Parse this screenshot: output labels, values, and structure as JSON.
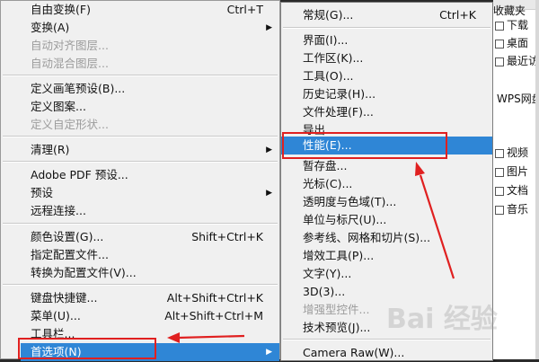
{
  "edit_menu": {
    "items": [
      {
        "label": "自由变换(F)",
        "shortcut": "Ctrl+T",
        "disabled": false
      },
      {
        "label": "变换(A)",
        "shortcut": "",
        "disabled": false
      },
      {
        "label": "自动对齐图层...",
        "shortcut": "",
        "disabled": true
      },
      {
        "label": "自动混合图层...",
        "shortcut": "",
        "disabled": true
      },
      {
        "label": "定义画笔预设(B)...",
        "shortcut": "",
        "disabled": false
      },
      {
        "label": "定义图案...",
        "shortcut": "",
        "disabled": false
      },
      {
        "label": "定义自定形状...",
        "shortcut": "",
        "disabled": true
      },
      {
        "label": "清理(R)",
        "shortcut": "",
        "disabled": false
      },
      {
        "label": "Adobe PDF 预设...",
        "shortcut": "",
        "disabled": false
      },
      {
        "label": "预设",
        "shortcut": "",
        "disabled": false
      },
      {
        "label": "远程连接...",
        "shortcut": "",
        "disabled": false
      },
      {
        "label": "颜色设置(G)...",
        "shortcut": "Shift+Ctrl+K",
        "disabled": false
      },
      {
        "label": "指定配置文件...",
        "shortcut": "",
        "disabled": false
      },
      {
        "label": "转换为配置文件(V)...",
        "shortcut": "",
        "disabled": false
      },
      {
        "label": "键盘快捷键...",
        "shortcut": "Alt+Shift+Ctrl+K",
        "disabled": false
      },
      {
        "label": "菜单(U)...",
        "shortcut": "Alt+Shift+Ctrl+M",
        "disabled": false
      },
      {
        "label": "工具栏...",
        "shortcut": "",
        "disabled": false
      },
      {
        "label": "首选项(N)",
        "shortcut": "",
        "disabled": false
      }
    ]
  },
  "pref_menu": {
    "items": [
      {
        "label": "常规(G)...",
        "shortcut": "Ctrl+K",
        "disabled": false
      },
      {
        "label": "界面(I)...",
        "shortcut": "",
        "disabled": false
      },
      {
        "label": "工作区(K)...",
        "shortcut": "",
        "disabled": false
      },
      {
        "label": "工具(O)...",
        "shortcut": "",
        "disabled": false
      },
      {
        "label": "历史记录(H)...",
        "shortcut": "",
        "disabled": false
      },
      {
        "label": "文件处理(F)...",
        "shortcut": "",
        "disabled": false
      },
      {
        "label": "导出...",
        "shortcut": "",
        "disabled": false
      },
      {
        "label": "性能(E)...",
        "shortcut": "",
        "disabled": false
      },
      {
        "label": "暂存盘...",
        "shortcut": "",
        "disabled": false
      },
      {
        "label": "光标(C)...",
        "shortcut": "",
        "disabled": false
      },
      {
        "label": "透明度与色域(T)...",
        "shortcut": "",
        "disabled": false
      },
      {
        "label": "单位与标尺(U)...",
        "shortcut": "",
        "disabled": false
      },
      {
        "label": "参考线、网格和切片(S)...",
        "shortcut": "",
        "disabled": false
      },
      {
        "label": "增效工具(P)...",
        "shortcut": "",
        "disabled": false
      },
      {
        "label": "文字(Y)...",
        "shortcut": "",
        "disabled": false
      },
      {
        "label": "3D(3)...",
        "shortcut": "",
        "disabled": false
      },
      {
        "label": "增强型控件...",
        "shortcut": "",
        "disabled": true
      },
      {
        "label": "技术预览(J)...",
        "shortcut": "",
        "disabled": false
      },
      {
        "label": "Camera Raw(W)...",
        "shortcut": "",
        "disabled": false
      }
    ]
  },
  "right_panel": {
    "header": "收藏夹",
    "items": [
      "下载",
      "桌面",
      "最近访",
      "WPS网盘",
      "视频",
      "图片",
      "文档",
      "音乐"
    ]
  },
  "watermark": "Bai 经验",
  "colors": {
    "highlight": "#2f86d6",
    "annotation": "#e02020",
    "menu_bg": "#f0f0f0"
  }
}
